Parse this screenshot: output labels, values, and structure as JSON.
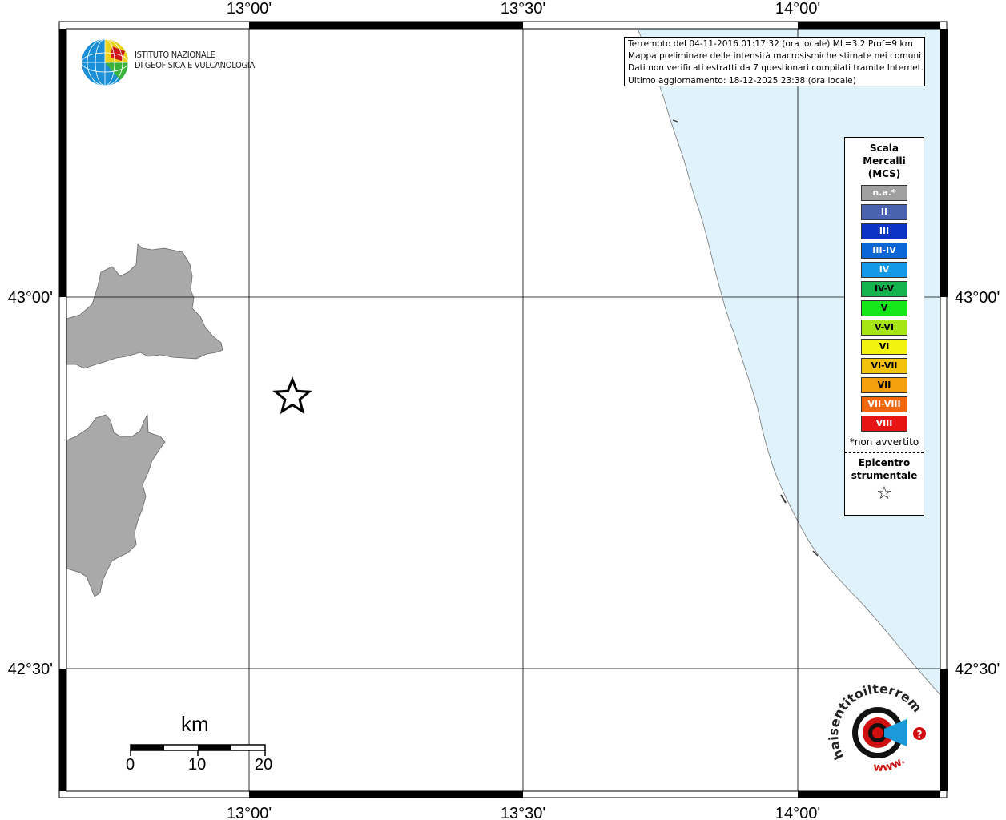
{
  "ticks": {
    "lon": [
      "13°00'",
      "13°30'",
      "14°00'"
    ],
    "lat": [
      "43°00'",
      "42°30'"
    ]
  },
  "info": {
    "line1": "Terremoto del 04-11-2016 01:17:32 (ora locale) ML=3.2 Prof=9 km",
    "line2": "Mappa preliminare delle intensità macrosismiche stimate nei comuni",
    "line3": "Dati non verificati estratti da 7 questionari compilati tramite Internet.",
    "line4": "Ultimo aggiornamento: 18-12-2025 23:38 (ora locale)"
  },
  "logo": {
    "line1": "ISTITUTO NAZIONALE",
    "line2": "DI GEOFISICA E VULCANOLOGIA"
  },
  "legend": {
    "title": [
      "Scala",
      "Mercalli",
      "(MCS)"
    ],
    "items": [
      {
        "label": "n.a.*",
        "color": "#a0a0a0"
      },
      {
        "label": "II",
        "color": "#4a63b0"
      },
      {
        "label": "III",
        "color": "#0d33c4"
      },
      {
        "label": "III-IV",
        "color": "#0d66d6"
      },
      {
        "label": "IV",
        "color": "#1499e6"
      },
      {
        "label": "IV-V",
        "color": "#14b34d"
      },
      {
        "label": "V",
        "color": "#14e61a"
      },
      {
        "label": "V-VI",
        "color": "#a6e614"
      },
      {
        "label": "VI",
        "color": "#f2f20f"
      },
      {
        "label": "VI-VII",
        "color": "#f2c20d"
      },
      {
        "label": "VII",
        "color": "#f2a00d"
      },
      {
        "label": "VII-VIII",
        "color": "#f2660d"
      },
      {
        "label": "VIII",
        "color": "#e61414"
      }
    ],
    "note": "*non avvertito",
    "epicenter": [
      "Epicentro",
      "strumentale"
    ],
    "star": "☆"
  },
  "scalebar": {
    "unit": "km",
    "labels": [
      "0",
      "10",
      "20"
    ]
  },
  "watermark": {
    "text1": "haisentitoilterremoto.it",
    "text2": "www."
  },
  "colors": {
    "sea": "#e0f2fc",
    "land_gray": "#a9a9a9",
    "grid": "#000000"
  }
}
